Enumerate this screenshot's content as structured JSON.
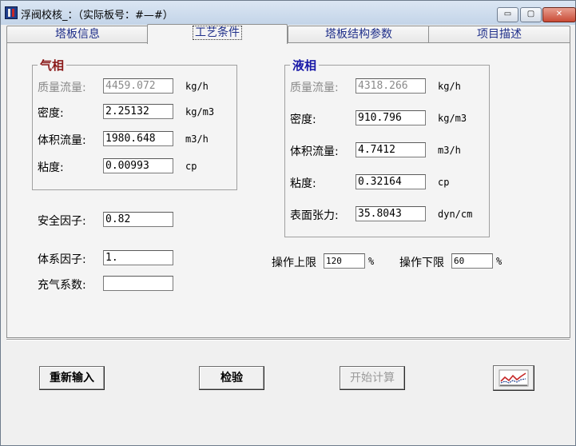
{
  "window": {
    "title": "浮阀校核_：（实际板号：#—#）",
    "minimize_symbol": "▭",
    "maximize_symbol": "▢",
    "close_symbol": "✕"
  },
  "tabs": [
    {
      "label": "塔板信息",
      "active": false
    },
    {
      "label": "工艺条件",
      "active": true
    },
    {
      "label": "塔板结构参数",
      "active": false
    },
    {
      "label": "项目描述",
      "active": false
    }
  ],
  "vapor": {
    "title": "气相",
    "title_color": "#8b1a1a",
    "rows": [
      {
        "label": "质量流量:",
        "value": "4459.072",
        "unit": "kg/h",
        "disabled": true
      },
      {
        "label": "密度:",
        "value": "2.25132",
        "unit": "kg/m3",
        "disabled": false
      },
      {
        "label": "体积流量:",
        "value": "1980.648",
        "unit": "m3/h",
        "disabled": false
      },
      {
        "label": "粘度:",
        "value": "0.00993",
        "unit": "cp",
        "disabled": false
      }
    ]
  },
  "liquid": {
    "title": "液相",
    "title_color": "#1a1aa8",
    "rows": [
      {
        "label": "质量流量:",
        "value": "4318.266",
        "unit": "kg/h",
        "disabled": true
      },
      {
        "label": "密度:",
        "value": "910.796",
        "unit": "kg/m3",
        "disabled": false
      },
      {
        "label": "体积流量:",
        "value": "4.7412",
        "unit": "m3/h",
        "disabled": false
      },
      {
        "label": "粘度:",
        "value": "0.32164",
        "unit": "cp",
        "disabled": false
      },
      {
        "label": "表面张力:",
        "value": "35.8043",
        "unit": "dyn/cm",
        "disabled": false
      }
    ]
  },
  "safety_factor": {
    "label": "安全因子:",
    "value": "0.82"
  },
  "system_factor": {
    "label": "体系因子:",
    "value": "1."
  },
  "aeration": {
    "label": "充气系数:",
    "value": ""
  },
  "op_upper": {
    "label": "操作上限",
    "value": "120",
    "unit": "%"
  },
  "op_lower": {
    "label": "操作下限",
    "value": "60",
    "unit": "%"
  },
  "buttons": {
    "reinput": "重新输入",
    "check": "检验",
    "start": "开始计算",
    "chart_icon": "chart-icon"
  }
}
